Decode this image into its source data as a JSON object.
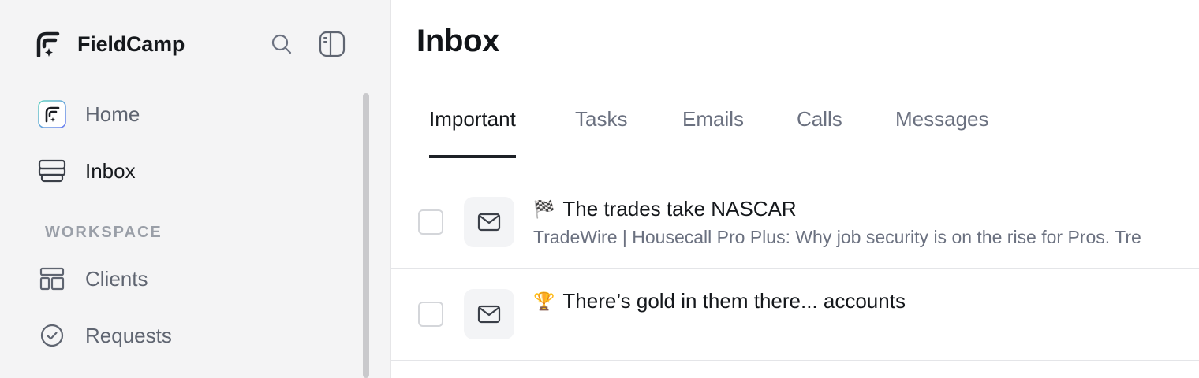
{
  "app": {
    "name": "FieldCamp"
  },
  "sidebar": {
    "nav": [
      {
        "label": "Home",
        "icon": "fieldcamp-logo-icon"
      },
      {
        "label": "Inbox",
        "icon": "inbox-icon"
      }
    ],
    "section_label": "WORKSPACE",
    "workspace": [
      {
        "label": "Clients",
        "icon": "layout-icon"
      },
      {
        "label": "Requests",
        "icon": "check-circle-icon"
      }
    ]
  },
  "main": {
    "title": "Inbox",
    "tabs": [
      {
        "label": "Important",
        "active": true
      },
      {
        "label": "Tasks"
      },
      {
        "label": "Emails"
      },
      {
        "label": "Calls"
      },
      {
        "label": "Messages"
      }
    ],
    "messages": [
      {
        "emoji": "🏁",
        "title": "The trades take NASCAR",
        "preview": "TradeWire | Housecall Pro Plus: Why job security is on the rise for Pros. Tre",
        "icon": "mail-icon"
      },
      {
        "emoji": "🏆",
        "title": "There’s gold in them there... accounts",
        "preview": "",
        "icon": "mail-icon"
      }
    ]
  },
  "colors": {
    "sidebar_bg": "#f4f4f5",
    "text_primary": "#15181c",
    "text_muted": "#6b7180",
    "tab_indicator": "#1d2026"
  }
}
